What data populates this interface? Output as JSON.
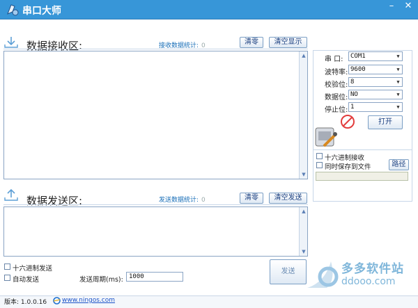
{
  "window": {
    "title": "串口大师",
    "minimize": "–",
    "close": "✕"
  },
  "receive": {
    "title": "数据接收区:",
    "stat_label": "接收数据统计:",
    "stat_value": "0",
    "clear_button": "清零",
    "clear_display_button": "清空显示"
  },
  "send": {
    "title": "数据发送区:",
    "stat_label": "发送数据统计:",
    "stat_value": "0",
    "clear_button": "清零",
    "clear_send_button": "清空发送",
    "send_button": "发送"
  },
  "serial": {
    "port_label": "串  口:",
    "port_value": "COM1",
    "baud_label": "波特率:",
    "baud_value": "9600",
    "parity_label": "校验位:",
    "parity_value": "8",
    "databits_label": "数据位:",
    "databits_value": "NO",
    "stopbits_label": "停止位:",
    "stopbits_value": "1",
    "open_button": "打开"
  },
  "options": {
    "hex_receive": "十六进制接收",
    "save_to_file": "同时保存到文件",
    "path_button": "路径",
    "hex_send": "十六进制发送",
    "auto_send": "自动发送",
    "period_label": "发送周期(ms):",
    "period_value": "1000"
  },
  "status": {
    "version": "版本: 1.0.0.16",
    "website": "www.ningos.com"
  },
  "watermark": {
    "name": "多多软件站",
    "url": "ddooo.com"
  }
}
